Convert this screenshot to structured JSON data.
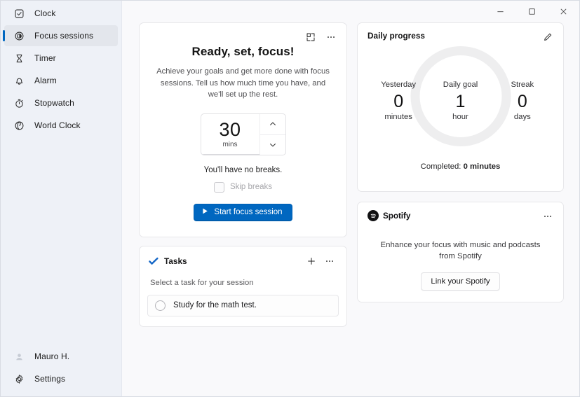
{
  "window": {
    "app_title": "Clock",
    "minimize_label": "Minimize",
    "maximize_label": "Maximize",
    "close_label": "Close"
  },
  "sidebar": {
    "items": [
      {
        "label": "Clock",
        "icon": "clock-app-icon",
        "selected": false
      },
      {
        "label": "Focus sessions",
        "icon": "focus-sessions-icon",
        "selected": true
      },
      {
        "label": "Timer",
        "icon": "hourglass-icon",
        "selected": false
      },
      {
        "label": "Alarm",
        "icon": "bell-icon",
        "selected": false
      },
      {
        "label": "Stopwatch",
        "icon": "stopwatch-icon",
        "selected": false
      },
      {
        "label": "World Clock",
        "icon": "globe-icon",
        "selected": false
      }
    ],
    "bottom": [
      {
        "label": "Mauro H.",
        "icon": "account-avatar-icon"
      },
      {
        "label": "Settings",
        "icon": "gear-icon"
      }
    ]
  },
  "focus": {
    "mini_view_icon": "mini-view-icon",
    "more_icon": "more-options-icon",
    "title": "Ready, set, focus!",
    "description": "Achieve your goals and get more done with focus sessions. Tell us how much time you have, and we'll set up the rest.",
    "duration_value": "30",
    "duration_unit": "mins",
    "increase_icon": "chevron-up-icon",
    "decrease_icon": "chevron-down-icon",
    "breaks_note": "You'll have no breaks.",
    "skip_breaks_label": "Skip breaks",
    "skip_breaks_checked": false,
    "skip_breaks_disabled": true,
    "start_button_label": "Start focus session",
    "start_button_icon": "play-icon",
    "accent_color": "#0067c0"
  },
  "tasks": {
    "icon": "todo-check-icon",
    "title": "Tasks",
    "add_icon": "plus-icon",
    "more_icon": "more-options-icon",
    "subtitle": "Select a task for your session",
    "items": [
      {
        "text": "Study for the math test.",
        "checked": false
      }
    ]
  },
  "daily_progress": {
    "title": "Daily progress",
    "edit_icon": "pencil-icon",
    "ring_color": "#eeeeef",
    "ring_progress_percent": 0,
    "stats": [
      {
        "label": "Yesterday",
        "value": "0",
        "unit": "minutes"
      },
      {
        "label": "Daily goal",
        "value": "1",
        "unit": "hour"
      },
      {
        "label": "Streak",
        "value": "0",
        "unit": "days"
      }
    ],
    "completed_prefix": "Completed: ",
    "completed_value": "0 minutes"
  },
  "spotify": {
    "logo_icon": "spotify-icon",
    "name": "Spotify",
    "more_icon": "more-options-icon",
    "description": "Enhance your focus with music and podcasts from Spotify",
    "link_button_label": "Link your Spotify"
  }
}
